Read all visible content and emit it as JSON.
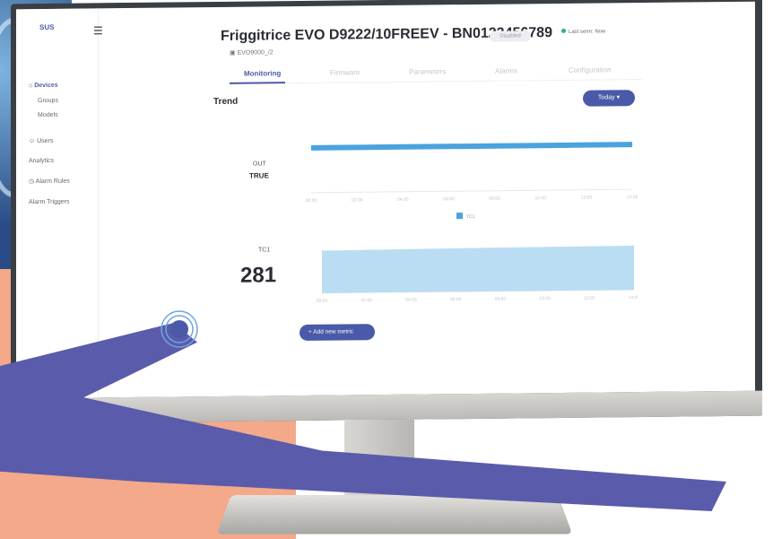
{
  "app": {
    "logo_text": "SUS",
    "device_title": "Friggitrice EVO D9222/10FREEV - BN0123456789",
    "device_badge": "Disabled",
    "status": "Last seen: Now",
    "device_subid": "EVO9000_/2"
  },
  "sidebar": {
    "items": [
      {
        "label": "Devices",
        "active": true
      },
      {
        "label": "Groups",
        "active": false
      },
      {
        "label": "Models",
        "active": false
      },
      {
        "label": "Users",
        "active": false
      },
      {
        "label": "Analytics",
        "active": false
      },
      {
        "label": "Alarm Rules",
        "active": false
      },
      {
        "label": "Alarm Triggers",
        "active": false
      }
    ]
  },
  "tabs": [
    {
      "label": "Monitoring",
      "active": true
    },
    {
      "label": "Firmware",
      "active": false
    },
    {
      "label": "Parameters",
      "active": false
    },
    {
      "label": "Alarms",
      "active": false
    },
    {
      "label": "Configuration",
      "active": false
    }
  ],
  "trend": {
    "label": "Trend",
    "range_button": "Today"
  },
  "metrics": [
    {
      "name": "OUT",
      "value": "TRUE"
    },
    {
      "name": "TC1",
      "value": "281"
    }
  ],
  "chart_data": [
    {
      "type": "line",
      "title": "",
      "x": [
        "00:00",
        "02:00",
        "04:00",
        "06:00",
        "08:00",
        "10:00",
        "12:00",
        "14:00"
      ],
      "series": [
        {
          "name": "",
          "values": [
            1,
            1,
            1,
            1,
            1,
            1,
            1,
            1
          ]
        }
      ],
      "ylim": [
        0,
        1.2
      ],
      "color": "#4aa3df"
    },
    {
      "type": "area",
      "title": "",
      "x": [
        "00:00",
        "02:00",
        "04:00",
        "06:00",
        "08:00",
        "10:00",
        "12:00",
        "14:00"
      ],
      "series": [
        {
          "name": "",
          "values": [
            270,
            272,
            274,
            276,
            278,
            279,
            280,
            281
          ]
        }
      ],
      "ylim": [
        0,
        320
      ],
      "color": "#b3d9f2",
      "legend_label": "TC1"
    }
  ],
  "actions": {
    "add_metric": "+ Add new metric"
  }
}
